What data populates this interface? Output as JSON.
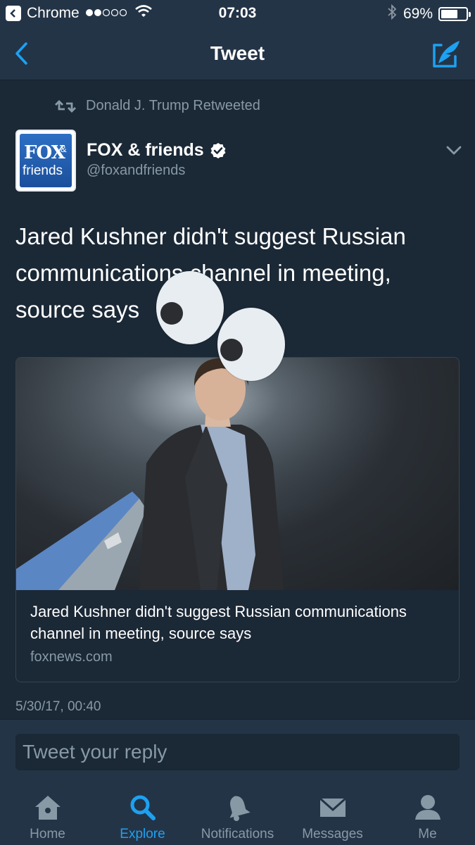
{
  "status_bar": {
    "carrier": "Chrome",
    "time": "07:03",
    "battery_percent": "69%",
    "battery_level": 0.69
  },
  "nav": {
    "title": "Tweet"
  },
  "tweet": {
    "retweet_by": "Donald J. Trump Retweeted",
    "author_name": "FOX & friends",
    "author_handle": "@foxandfriends",
    "avatar_logo_line1": "FOX",
    "avatar_logo_amp": "&",
    "avatar_logo_line2": "friends",
    "text": "Jared Kushner didn't suggest Russian communications channel in meeting, source says",
    "card": {
      "title": "Jared Kushner didn't suggest Russian communications channel in meeting, source says",
      "domain": "foxnews.com"
    },
    "timestamp": "5/30/17, 00:40"
  },
  "reply": {
    "placeholder": "Tweet your reply"
  },
  "tabbar": {
    "items": [
      {
        "label": "Home",
        "icon": "home-icon",
        "active": false
      },
      {
        "label": "Explore",
        "icon": "search-icon",
        "active": true
      },
      {
        "label": "Notifications",
        "icon": "bell-icon",
        "active": false
      },
      {
        "label": "Messages",
        "icon": "envelope-icon",
        "active": false
      },
      {
        "label": "Me",
        "icon": "person-icon",
        "active": false
      }
    ]
  },
  "colors": {
    "background": "#1b2836",
    "bar": "#243447",
    "accent": "#1da1f2",
    "secondary_text": "#8899a6"
  }
}
